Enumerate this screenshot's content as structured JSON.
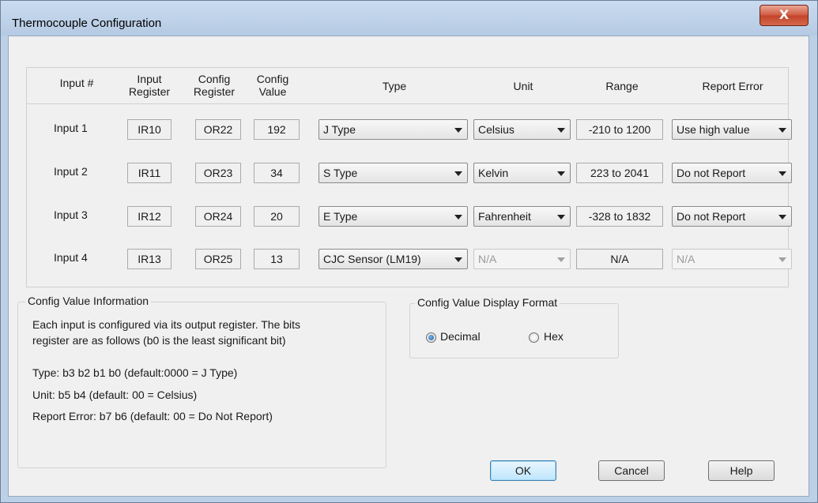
{
  "window": {
    "title": "Thermocouple Configuration",
    "close_label": "X"
  },
  "table": {
    "headers": {
      "input": "Input #",
      "input_register_1": "Input",
      "input_register_2": "Register",
      "config_register_1": "Config",
      "config_register_2": "Register",
      "config_value_1": "Config",
      "config_value_2": "Value",
      "type": "Type",
      "unit": "Unit",
      "range": "Range",
      "report_error": "Report Error"
    },
    "rows": [
      {
        "label": "Input 1",
        "input_register": "IR10",
        "config_register": "OR22",
        "config_value": "192",
        "type": "J Type",
        "unit": "Celsius",
        "range": "-210 to 1200",
        "report_error": "Use high value"
      },
      {
        "label": "Input 2",
        "input_register": "IR11",
        "config_register": "OR23",
        "config_value": "34",
        "type": "S Type",
        "unit": "Kelvin",
        "range": "223 to 2041",
        "report_error": "Do not Report"
      },
      {
        "label": "Input 3",
        "input_register": "IR12",
        "config_register": "OR24",
        "config_value": "20",
        "type": "E Type",
        "unit": "Fahrenheit",
        "range": "-328 to 1832",
        "report_error": "Do not Report"
      },
      {
        "label": "Input 4",
        "input_register": "IR13",
        "config_register": "OR25",
        "config_value": "13",
        "type": "CJC Sensor (LM19)",
        "unit": "N/A",
        "range": "N/A",
        "report_error": "N/A"
      }
    ]
  },
  "config_info": {
    "title": "Config Value Information",
    "line1": "Each input is configured via its output register.  The bits",
    "line2": "register are as follows (b0 is the least significant bit)",
    "type_line": "Type: b3 b2 b1 b0 (default:0000 = J Type)",
    "unit_line": "Unit: b5 b4 (default: 00 = Celsius)",
    "report_line": "Report Error: b7 b6 (default: 00 = Do Not Report)"
  },
  "display_format": {
    "title": "Config Value Display Format",
    "decimal_label": "Decimal",
    "hex_label": "Hex",
    "selected": "Decimal"
  },
  "buttons": {
    "ok": "OK",
    "cancel": "Cancel",
    "help": "Help"
  }
}
